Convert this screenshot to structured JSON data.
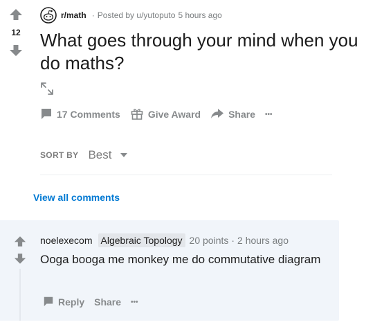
{
  "post": {
    "score": "12",
    "subreddit": "r/math",
    "separator": "·",
    "posted_by": "Posted by u/yutoputo",
    "time": "5 hours ago",
    "title": "What goes through your mind when you do maths?",
    "actions": {
      "comments": "17 Comments",
      "give_award": "Give Award",
      "share": "Share",
      "more": "•••"
    },
    "icons": {
      "upvote": "upvote-arrow-icon",
      "downvote": "downvote-arrow-icon",
      "avatar": "subreddit-avatar-icon",
      "expand": "expand-icon",
      "comments": "comment-bubble-icon",
      "award": "gift-icon",
      "share": "share-arrow-icon"
    }
  },
  "sort": {
    "label": "SORT BY",
    "value": "Best"
  },
  "view_all_comments": "View all comments",
  "comment": {
    "author": "noelexecom",
    "flair": "Algebraic Topology",
    "points": "20 points",
    "separator": "·",
    "time": "2 hours ago",
    "body": "Ooga booga me monkey me do commutative diagram",
    "actions": {
      "reply": "Reply",
      "share": "Share",
      "more": "•••"
    }
  },
  "colors": {
    "link_blue": "#0079d3",
    "muted_gray": "#878a8c",
    "comment_bg": "#f1f5fa",
    "flair_bg": "#e3e6ea"
  }
}
